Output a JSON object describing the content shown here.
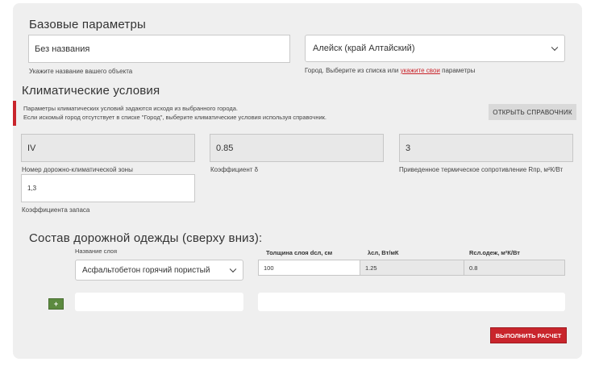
{
  "basic": {
    "title": "Базовые параметры",
    "name_value": "Без названия",
    "name_hint": "Укажите название вашего объекта",
    "city_value": "Алейск (край Алтайский)",
    "city_hint_prefix": "Город. Выберите из списка или ",
    "city_hint_link": "укажите свои",
    "city_hint_suffix": " параметры"
  },
  "climate": {
    "title": "Климатические условия",
    "notice_line1": "Параметры климатических условий задаются исходя из выбранного города.",
    "notice_line2": "Если искомый город отсутствует в списке \"Город\", выберите климатические условия используя справочник.",
    "open_reference_label": "ОТКРЫТЬ СПРАВОЧНИК",
    "zone_value": "IV",
    "zone_label": "Номер дорожно-климатической зоны",
    "delta_value": "0.85",
    "delta_label": "Коэффициент δ",
    "rpr_value": "3",
    "rpr_label": "Приведенное термическое сопротивление Rпр, м²К/Вт",
    "reserve_value": "1,3",
    "reserve_label": "Коэффициента запаса"
  },
  "layers": {
    "title": "Состав дорожной одежды (сверху вниз):",
    "col_name": "Название слоя",
    "col_thickness": "Толщина слоя dсл, см",
    "col_lambda": "λсл, Вт/мК",
    "col_r": "Rсл.одеж, м²К/Вт",
    "rows": [
      {
        "name": "Асфальтобетон горячий пористый",
        "thickness": "100",
        "lambda": "1.25",
        "r": "0.8"
      }
    ],
    "add_label": "+",
    "calculate_label": "ВЫПОЛНИТЬ РАСЧЕТ"
  },
  "colors": {
    "accent_red": "#c9252c",
    "add_green": "#5c8a3f",
    "panel_bg": "#efefef"
  },
  "icons": {
    "select_arrow": "chevron-down-icon",
    "add": "plus-icon"
  }
}
